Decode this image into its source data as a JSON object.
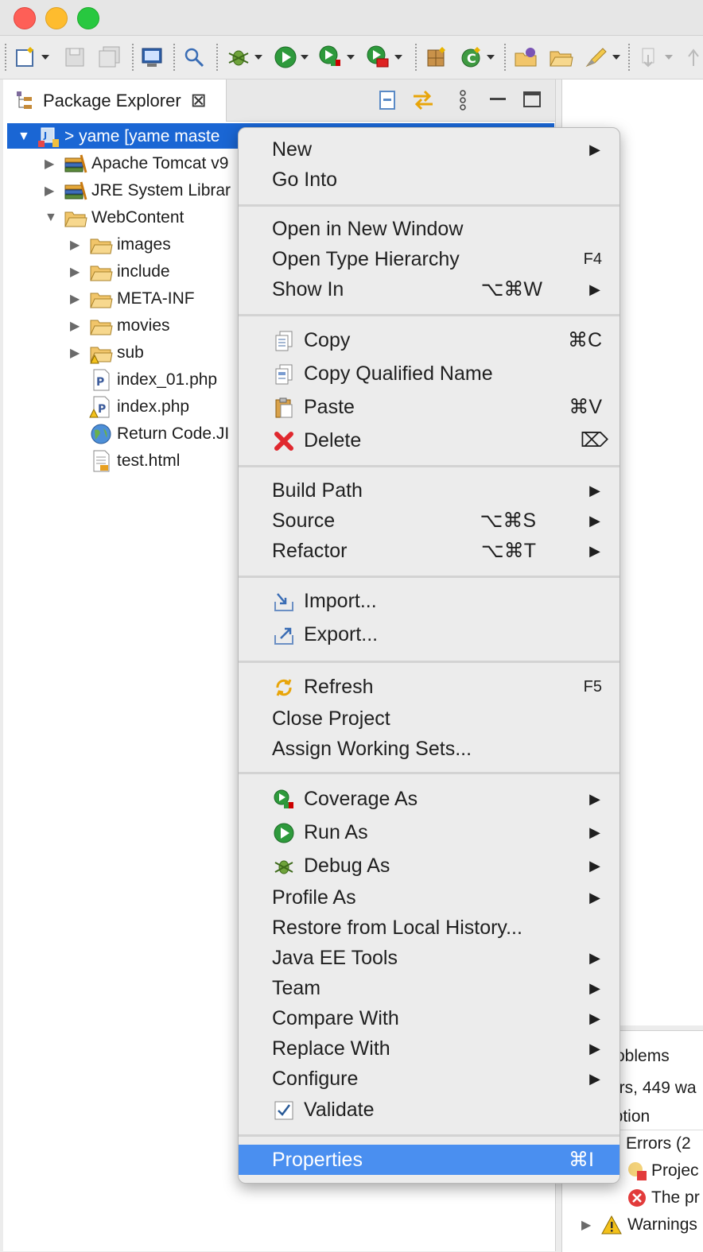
{
  "package_explorer": {
    "tab_title": "Package Explorer",
    "close_glyph": "⊠"
  },
  "tree": [
    {
      "label": "> yame [yame maste",
      "icon": "project-icon",
      "expanded": true,
      "selected": true,
      "level": 0
    },
    {
      "label": "Apache Tomcat v9",
      "icon": "library-icon",
      "expanded": false,
      "level": 1
    },
    {
      "label": "JRE System Librar",
      "icon": "library-icon",
      "expanded": false,
      "level": 1
    },
    {
      "label": "WebContent",
      "icon": "folder-icon",
      "expanded": true,
      "level": 1
    },
    {
      "label": "images",
      "icon": "folder-icon",
      "expanded": false,
      "level": 2
    },
    {
      "label": "include",
      "icon": "folder-icon",
      "expanded": false,
      "level": 2
    },
    {
      "label": "META-INF",
      "icon": "folder-icon",
      "expanded": false,
      "level": 2
    },
    {
      "label": "movies",
      "icon": "folder-icon",
      "expanded": false,
      "level": 2
    },
    {
      "label": "sub",
      "icon": "folder-warning-icon",
      "expanded": false,
      "level": 2
    },
    {
      "label": "index_01.php",
      "icon": "php-file-icon",
      "level": 2
    },
    {
      "label": "index.php",
      "icon": "php-file-warning-icon",
      "level": 2
    },
    {
      "label": "Return Code.JI",
      "icon": "web-file-icon",
      "level": 2
    },
    {
      "label": "test.html",
      "icon": "html-file-icon",
      "level": 2
    }
  ],
  "problems": {
    "tab_label": "roblems",
    "summary": "ors, 449 wa",
    "column": "iption",
    "errors": "Errors (2",
    "item1": "Projec",
    "item2": "The pr",
    "warnings": "Warnings"
  },
  "context_menu": {
    "items": [
      {
        "label": "New",
        "submenu": true
      },
      {
        "label": "Go Into"
      },
      {
        "label": "Open in New Window"
      },
      {
        "label": "Open Type Hierarchy",
        "shortcut": "F4"
      },
      {
        "label": "Show In",
        "shortcut": "⌥⌘W",
        "submenu": true
      },
      {
        "label": "Copy",
        "shortcut": "⌘C",
        "icon": "copy-icon"
      },
      {
        "label": "Copy Qualified Name",
        "icon": "copy-qualified-icon"
      },
      {
        "label": "Paste",
        "shortcut": "⌘V",
        "icon": "paste-icon"
      },
      {
        "label": "Delete",
        "shortcut": "⌦",
        "icon": "delete-icon"
      },
      {
        "label": "Build Path",
        "submenu": true
      },
      {
        "label": "Source",
        "shortcut": "⌥⌘S",
        "submenu": true
      },
      {
        "label": "Refactor",
        "shortcut": "⌥⌘T",
        "submenu": true
      },
      {
        "label": "Import...",
        "icon": "import-icon"
      },
      {
        "label": "Export...",
        "icon": "export-icon"
      },
      {
        "label": "Refresh",
        "shortcut": "F5",
        "icon": "refresh-icon"
      },
      {
        "label": "Close Project"
      },
      {
        "label": "Assign Working Sets..."
      },
      {
        "label": "Coverage As",
        "submenu": true,
        "icon": "coverage-icon"
      },
      {
        "label": "Run As",
        "submenu": true,
        "icon": "run-icon"
      },
      {
        "label": "Debug As",
        "submenu": true,
        "icon": "debug-icon"
      },
      {
        "label": "Profile As",
        "submenu": true
      },
      {
        "label": "Restore from Local History..."
      },
      {
        "label": "Java EE Tools",
        "submenu": true
      },
      {
        "label": "Team",
        "submenu": true
      },
      {
        "label": "Compare With",
        "submenu": true
      },
      {
        "label": "Replace With",
        "submenu": true
      },
      {
        "label": "Configure",
        "submenu": true
      },
      {
        "label": "Validate",
        "icon": "checkbox-icon"
      },
      {
        "label": "Properties",
        "shortcut": "⌘I",
        "highlighted": true
      }
    ],
    "submenu_arrow": "▶"
  },
  "colors": {
    "selection": "#1a66d4",
    "menu_highlight": "#4a8ff0",
    "menu_background": "#ececec"
  }
}
